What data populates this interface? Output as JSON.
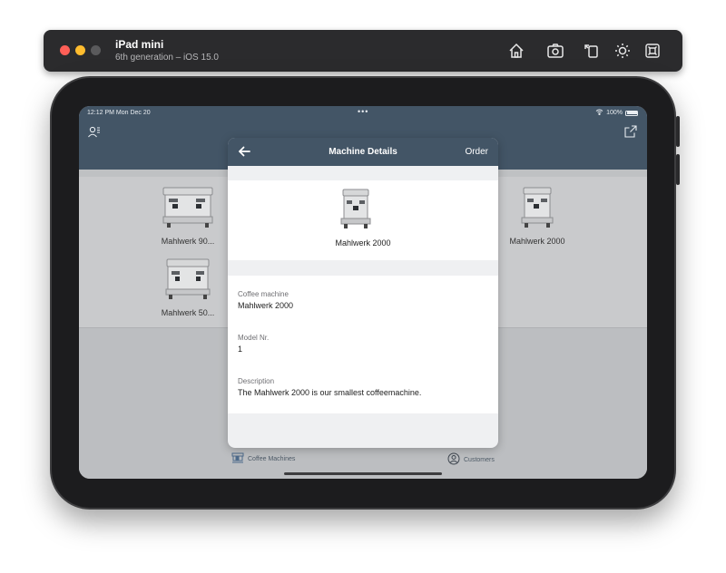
{
  "simulator": {
    "device_name": "iPad mini",
    "device_subtitle": "6th generation – iOS 15.0",
    "toolbar_icons": [
      "home-icon",
      "screenshot-icon",
      "rotate-icon",
      "appearance-icon",
      "keyboard-icon"
    ]
  },
  "status_bar": {
    "time": "12:12 PM  Mon Dec 20",
    "battery": "100%"
  },
  "grid": {
    "items": [
      {
        "label": "Mahlwerk 90..."
      },
      {
        "label": "Mahlwerk 2000"
      },
      {
        "label": "Mahlwerk 50..."
      }
    ]
  },
  "modal": {
    "title": "Machine Details",
    "action": "Order",
    "image_caption": "Mahlwerk 2000",
    "fields": [
      {
        "key": "Coffee machine",
        "value": "Mahlwerk 2000"
      },
      {
        "key": "Model Nr.",
        "value": "1"
      },
      {
        "key": "Description",
        "value": "The Mahlwerk 2000 is our smallest coffeemachine."
      }
    ]
  },
  "tabs": [
    {
      "label": "Coffee Machines"
    },
    {
      "label": "Customers"
    }
  ],
  "colors": {
    "nav": "#435566",
    "sheet_bg": "#eff0f2"
  }
}
